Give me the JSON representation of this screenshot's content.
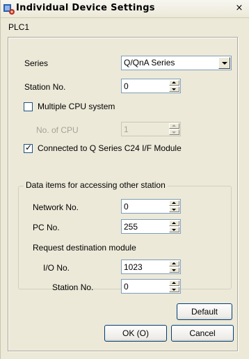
{
  "window": {
    "title": "Individual Device Settings",
    "close_glyph": "×"
  },
  "plc_label": "PLC1",
  "series": {
    "label": "Series",
    "value": "Q/QnA Series"
  },
  "station": {
    "label": "Station No.",
    "value": "0"
  },
  "multiple_cpu": {
    "label": "Multiple CPU system",
    "checked": false
  },
  "num_cpu": {
    "label": "No. of CPU",
    "value": "1"
  },
  "connected_c24": {
    "label": "Connected to Q Series C24 I/F Module",
    "checked": true,
    "mark": "✓"
  },
  "other_station": {
    "title": "Data items for accessing other station",
    "network": {
      "label": "Network No.",
      "value": "0"
    },
    "pc": {
      "label": "PC No.",
      "value": "255"
    },
    "request_label": "Request destination module",
    "io": {
      "label": "I/O No.",
      "value": "1023"
    },
    "station": {
      "label": "Station No.",
      "value": "0"
    }
  },
  "buttons": {
    "default": "Default",
    "ok": "OK (O)",
    "cancel": "Cancel"
  },
  "colors": {
    "face": "#ece9d8",
    "field_border": "#7f9db9",
    "button_border": "#003c74"
  }
}
